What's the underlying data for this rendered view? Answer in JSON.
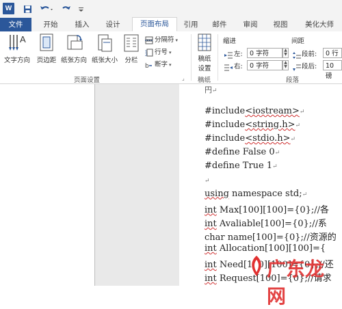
{
  "qat": {
    "logo": "W",
    "save_icon": "save-icon",
    "undo_icon": "undo-icon",
    "redo_icon": "redo-icon",
    "customize_icon": "customize-qat-icon"
  },
  "tabs": [
    "文件",
    "开始",
    "插入",
    "设计",
    "页面布局",
    "引用",
    "邮件",
    "审阅",
    "视图",
    "美化大师"
  ],
  "active_tab": "页面布局",
  "ribbon": {
    "page_setup": {
      "label": "页面设置",
      "text_direction": "文字方向",
      "margins": "页边距",
      "orientation": "纸张方向",
      "size": "纸张大小",
      "columns": "分栏",
      "breaks": "分隔符",
      "line_numbers": "行号",
      "hyphenation": "断字"
    },
    "manuscript": {
      "label": "稿纸",
      "setup_line1": "稿纸",
      "setup_line2": "设置"
    },
    "paragraph": {
      "label": "段落",
      "indent": "缩进",
      "spacing": "间距",
      "left_label": "左:",
      "left_value": "0 字符",
      "right_label": "右:",
      "right_value": "0 字符",
      "before_label": "段前:",
      "before_value": "0 行",
      "after_label": "段后:",
      "after_value": "10 磅"
    }
  },
  "document": {
    "top_partial": "円",
    "lines": [
      {
        "pre": "#include",
        "wave": "<iostream>",
        "post": ""
      },
      {
        "pre": "#include",
        "wave": "<string.h>",
        "post": ""
      },
      {
        "pre": "#include",
        "wave": "<stdio.h>",
        "post": ""
      },
      {
        "pre": "#define False 0",
        "wave": "",
        "post": ""
      },
      {
        "pre": "#define True 1",
        "wave": "",
        "post": ""
      },
      {
        "pre": "",
        "wave": "",
        "post": ""
      },
      {
        "pre": "",
        "wave": "using",
        "post": " namespace std;"
      },
      {
        "pre": "",
        "wave": "int",
        "post": " Max[100][100]={0};//各"
      },
      {
        "pre": "",
        "wave": "int",
        "post": " Avaliable[100]={0};//系"
      },
      {
        "pre": "char name[100]={0};//资源的",
        "wave": "",
        "post": ""
      },
      {
        "pre": "",
        "wave": "int",
        "post": " Allocation[100][100]={"
      },
      {
        "pre": "",
        "wave": "int",
        "post": " Need[100][100]={0};//还"
      },
      {
        "pre": "",
        "wave": "int",
        "post": " Request[100]={0};//请求"
      }
    ],
    "paragraph_mark": "↵"
  },
  "watermark": "广东龙网"
}
